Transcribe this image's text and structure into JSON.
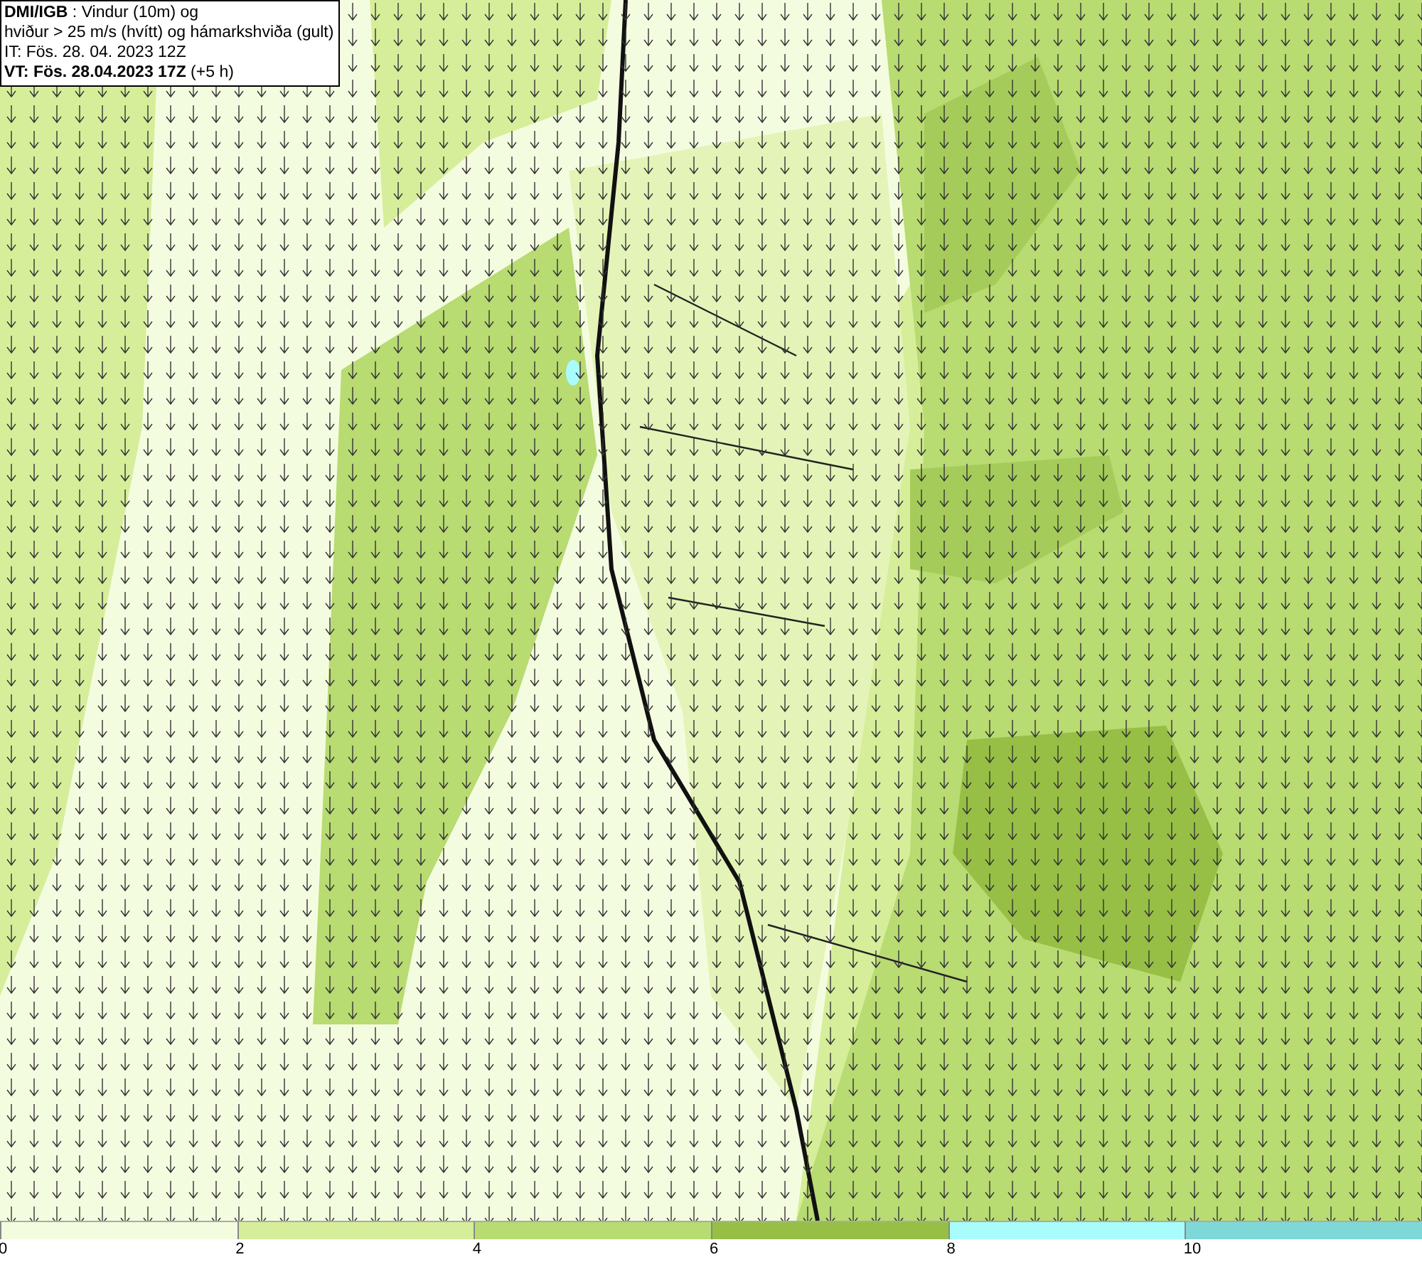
{
  "info_box": {
    "lines": [
      "**DMI/IGB** : Vindur (10m) og",
      "hviður > 25 m/s (hvítt) og hámarkshviða (gult)",
      "IT: Fös. 28. 04. 2023 12Z",
      "**VT: Fös. 28.04.2023 17Z** (+5 h)"
    ]
  },
  "legend": [
    {
      "label": "0",
      "color": "#f4fce0"
    },
    {
      "label": "2",
      "color": "#d6ee9a"
    },
    {
      "label": "4",
      "color": "#b8db72"
    },
    {
      "label": "6",
      "color": "#97bf45"
    },
    {
      "label": "8",
      "color": "#a8fcfc"
    },
    {
      "label": "10",
      "color": "#7fd8d8"
    }
  ]
}
